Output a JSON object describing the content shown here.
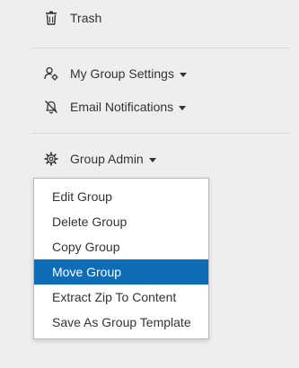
{
  "nav": {
    "trash": {
      "label": "Trash",
      "icon": "trash-icon"
    },
    "my_group_settings": {
      "label": "My Group Settings",
      "icon": "user-settings-icon"
    },
    "email_notifications": {
      "label": "Email Notifications",
      "icon": "bell-icon"
    },
    "group_admin": {
      "label": "Group Admin",
      "icon": "gear-icon"
    }
  },
  "group_admin_menu": {
    "items": [
      {
        "label": "Edit Group"
      },
      {
        "label": "Delete Group"
      },
      {
        "label": "Copy Group"
      },
      {
        "label": "Move Group",
        "highlighted": true
      },
      {
        "label": "Extract Zip To Content"
      },
      {
        "label": "Save As Group Template"
      }
    ]
  },
  "colors": {
    "highlight": "#0f6cb6",
    "background": "#eeeeee"
  }
}
